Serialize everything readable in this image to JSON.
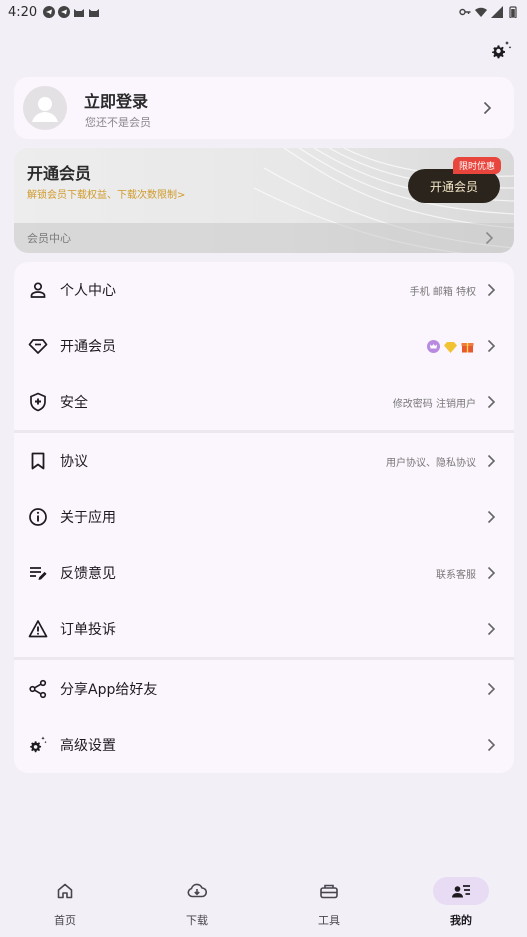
{
  "status_bar": {
    "time": "4:20"
  },
  "login": {
    "title": "立即登录",
    "subtitle": "您还不是会员"
  },
  "vip": {
    "title": "开通会员",
    "subtitle": "解锁会员下载权益、下载次数限制>",
    "button": "开通会员",
    "badge": "限时优惠",
    "footer": "会员中心"
  },
  "menu": {
    "items": [
      {
        "label": "个人中心",
        "hint": "手机 邮箱 特权",
        "icon": "person-icon"
      },
      {
        "label": "开通会员",
        "hint": "",
        "icon": "diamond-icon"
      },
      {
        "label": "安全",
        "hint": "修改密码  注销用户",
        "icon": "shield-icon"
      },
      {
        "label": "协议",
        "hint": "用户协议、隐私协议",
        "icon": "bookmark-icon"
      },
      {
        "label": "关于应用",
        "hint": "",
        "icon": "info-icon"
      },
      {
        "label": "反馈意见",
        "hint": "联系客服",
        "icon": "edit-list-icon"
      },
      {
        "label": "订单投诉",
        "hint": "",
        "icon": "warning-icon"
      },
      {
        "label": "分享App给好友",
        "hint": "",
        "icon": "share-icon"
      },
      {
        "label": "高级设置",
        "hint": "",
        "icon": "settings-icon"
      }
    ]
  },
  "nav": {
    "items": [
      {
        "label": "首页",
        "icon": "home-icon"
      },
      {
        "label": "下载",
        "icon": "cloud-download-icon"
      },
      {
        "label": "工具",
        "icon": "toolbox-icon"
      },
      {
        "label": "我的",
        "icon": "profile-list-icon"
      }
    ]
  },
  "colors": {
    "accent": "#e8dcf4",
    "vip_button": "#2b241c",
    "badge": "#e8453c",
    "vip_text": "#d09a2c"
  }
}
